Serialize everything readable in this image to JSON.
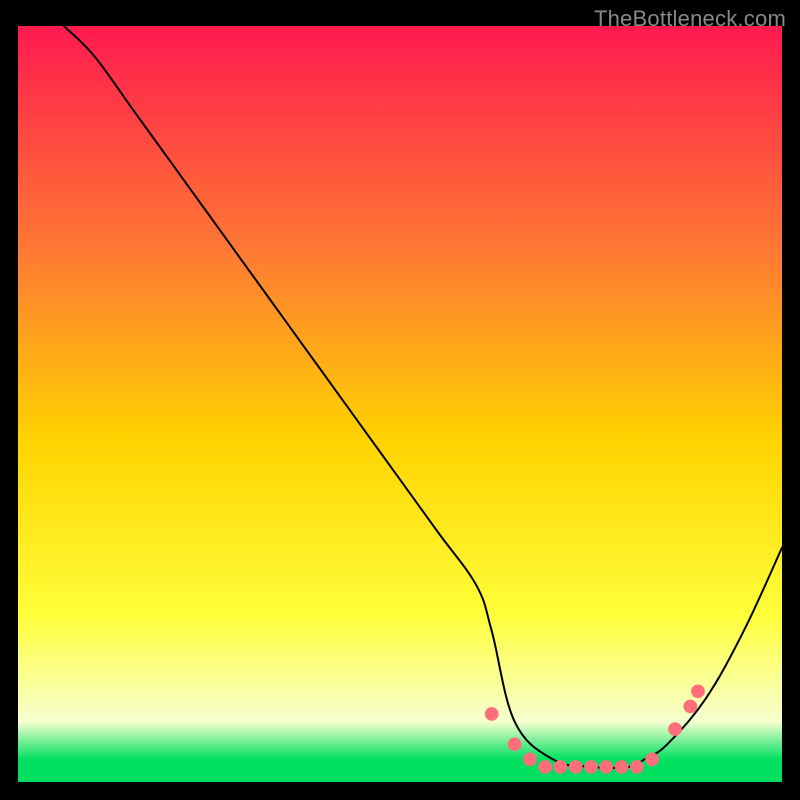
{
  "watermark": "TheBottleneck.com",
  "colors": {
    "top": "#ff1a4f",
    "mid1": "#ff7a33",
    "mid2": "#ffd400",
    "mid3": "#ffff3a",
    "pale": "#f7ffd0",
    "green": "#00e060",
    "black": "#000000",
    "curve": "#000000",
    "dot": "#ff6e7a"
  },
  "chart_data": {
    "type": "line",
    "title": "",
    "xlabel": "",
    "ylabel": "",
    "xlim": [
      0,
      100
    ],
    "ylim": [
      0,
      100
    ],
    "grid": false,
    "legend": false,
    "series": [
      {
        "name": "curve",
        "x": [
          6,
          10,
          15,
          20,
          25,
          30,
          35,
          40,
          45,
          50,
          55,
          60,
          62,
          65,
          70,
          75,
          80,
          82,
          85,
          90,
          95,
          100
        ],
        "y": [
          100,
          96,
          89,
          82,
          75,
          68,
          61,
          54,
          47,
          40,
          33,
          26,
          20,
          8,
          3,
          2,
          2,
          3,
          5,
          11,
          20,
          31
        ]
      }
    ],
    "points": [
      {
        "x": 62,
        "y": 9
      },
      {
        "x": 65,
        "y": 5
      },
      {
        "x": 67,
        "y": 3
      },
      {
        "x": 69,
        "y": 2
      },
      {
        "x": 71,
        "y": 2
      },
      {
        "x": 73,
        "y": 2
      },
      {
        "x": 75,
        "y": 2
      },
      {
        "x": 77,
        "y": 2
      },
      {
        "x": 79,
        "y": 2
      },
      {
        "x": 81,
        "y": 2
      },
      {
        "x": 83,
        "y": 3
      },
      {
        "x": 86,
        "y": 7
      },
      {
        "x": 88,
        "y": 10
      },
      {
        "x": 89,
        "y": 12
      }
    ]
  }
}
